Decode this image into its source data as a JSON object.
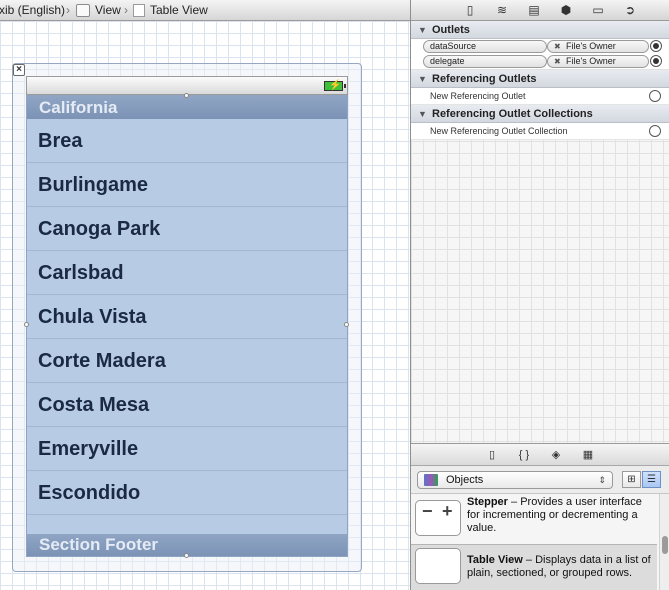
{
  "jumpbar": {
    "crumbs": [
      "xib (English)",
      "View",
      "Table View"
    ],
    "separator": "›"
  },
  "table": {
    "header": "California",
    "rows": [
      "Brea",
      "Burlingame",
      "Canoga Park",
      "Carlsbad",
      "Chula Vista",
      "Corte Madera",
      "Costa Mesa",
      "Emeryville",
      "Escondido"
    ],
    "footer": "Section Footer"
  },
  "inspector": {
    "toolbar_icons": [
      "file-icon",
      "quick-help-icon",
      "identity-icon",
      "attributes-icon",
      "size-icon",
      "connections-icon"
    ],
    "outlets": {
      "title": "Outlets",
      "items": [
        {
          "name": "dataSource",
          "target": "File's Owner"
        },
        {
          "name": "delegate",
          "target": "File's Owner"
        }
      ]
    },
    "referencing_outlets": {
      "title": "Referencing Outlets",
      "item": "New Referencing Outlet"
    },
    "referencing_collections": {
      "title": "Referencing Outlet Collections",
      "item": "New Referencing Outlet Collection"
    }
  },
  "library": {
    "tabs": [
      "file-templates-icon",
      "code-snippets-icon",
      "objects-icon",
      "media-icon"
    ],
    "filter": "Objects",
    "items": [
      {
        "title": "Stepper",
        "description": " – Provides a user interface for incrementing or decrementing a value."
      },
      {
        "title": "Table View",
        "description": " – Displays data in a list of plain, sectioned, or grouped rows."
      }
    ]
  }
}
